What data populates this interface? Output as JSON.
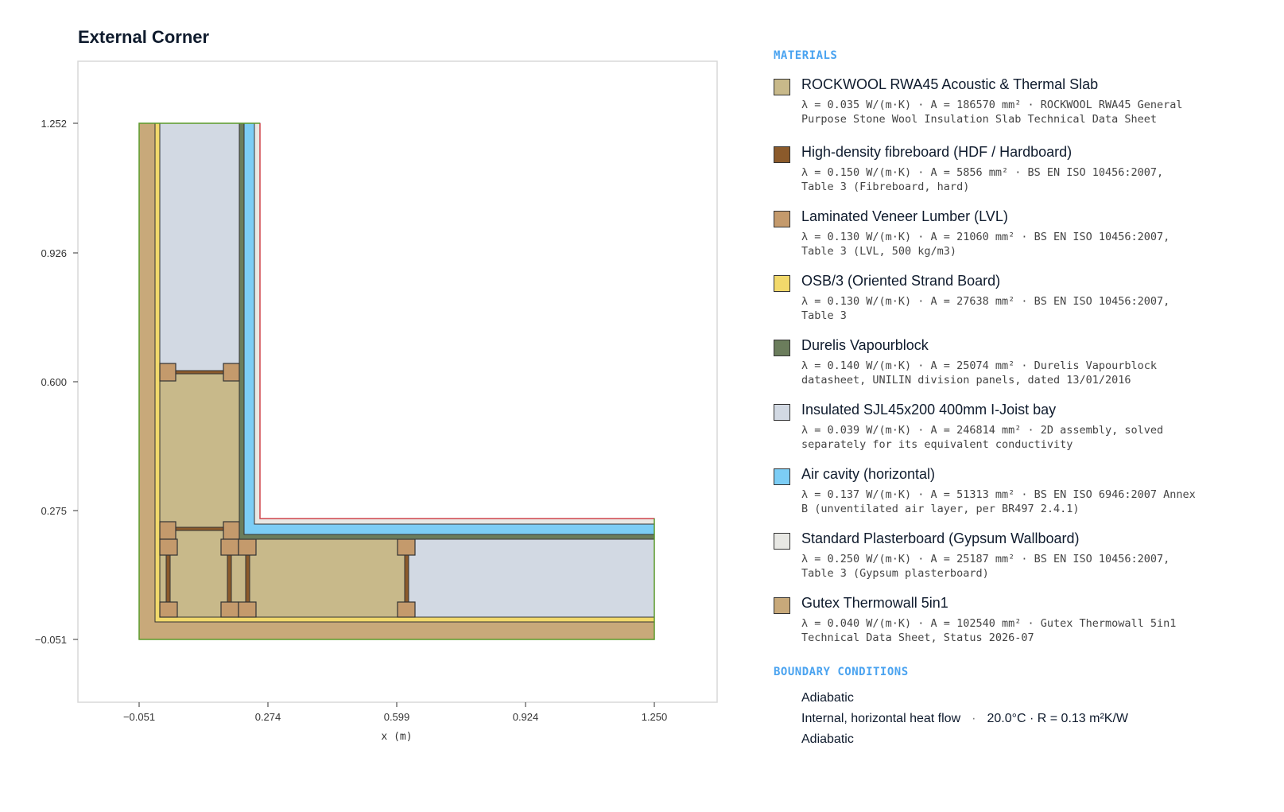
{
  "title": "External Corner",
  "axes": {
    "xlabel": "x (m)",
    "x_ticks": [
      "−0.051",
      "0.274",
      "0.599",
      "0.924",
      "1.250"
    ],
    "y_ticks": [
      "1.252",
      "0.926",
      "0.600",
      "0.275",
      "−0.051"
    ]
  },
  "materials_heading": "MATERIALS",
  "materials": [
    {
      "name": "ROCKWOOL RWA45 Acoustic & Thermal Slab",
      "meta": "λ = 0.035 W/(m·K) · A = 186570 mm² · ROCKWOOL RWA45 General Purpose Stone Wool Insulation Slab Technical Data Sheet",
      "color": "#c8b98a"
    },
    {
      "name": "High-density fibreboard (HDF / Hardboard)",
      "meta": "λ = 0.150 W/(m·K) · A = 5856 mm² · BS EN ISO 10456:2007, Table 3 (Fibreboard, hard)",
      "color": "#8b5a2b"
    },
    {
      "name": "Laminated Veneer Lumber (LVL)",
      "meta": "λ = 0.130 W/(m·K) · A = 21060 mm² · BS EN ISO 10456:2007, Table 3 (LVL, 500 kg/m3)",
      "color": "#c49a6c"
    },
    {
      "name": "OSB/3 (Oriented Strand Board)",
      "meta": "λ = 0.130 W/(m·K) · A = 27638 mm² · BS EN ISO 10456:2007, Table 3",
      "color": "#f2d96b"
    },
    {
      "name": "Durelis Vapourblock",
      "meta": "λ = 0.140 W/(m·K) · A = 25074 mm² · Durelis Vapourblock datasheet, UNILIN division panels, dated 13/01/2016",
      "color": "#6b7d5c"
    },
    {
      "name": "Insulated SJL45x200 400mm I-Joist bay",
      "meta": "λ = 0.039 W/(m·K) · A = 246814 mm² · 2D assembly, solved separately for its equivalent conductivity",
      "color": "#d2d9e3"
    },
    {
      "name": "Air cavity (horizontal)",
      "meta": "λ = 0.137 W/(m·K) · A = 51313 mm² · BS EN ISO 6946:2007 Annex B (unventilated air layer, per BR497 2.4.1)",
      "color": "#7ccdf5"
    },
    {
      "name": "Standard Plasterboard (Gypsum Wallboard)",
      "meta": "λ = 0.250 W/(m·K) · A = 25187 mm² · BS EN ISO 10456:2007, Table 3 (Gypsum plasterboard)",
      "color": "#e8e8e4"
    },
    {
      "name": "Gutex Thermowall 5in1",
      "meta": "λ = 0.040 W/(m·K) · A = 102540 mm² · Gutex Thermowall 5in1 Technical Data Sheet, Status 2026-07",
      "color": "#c8a97a"
    }
  ],
  "boundary_heading": "BOUNDARY CONDITIONS",
  "boundary_conditions": [
    {
      "label": "Adiabatic",
      "detail": ""
    },
    {
      "label": "Internal, horizontal heat flow",
      "detail": "20.0°C · R = 0.13 m²K/W"
    },
    {
      "label": "Adiabatic",
      "detail": ""
    }
  ],
  "colors": {
    "exterior_edge": "#5a9a2a",
    "interior_edge": "#d0454c",
    "outline": "#222222",
    "frame": "#d8d8d8"
  }
}
